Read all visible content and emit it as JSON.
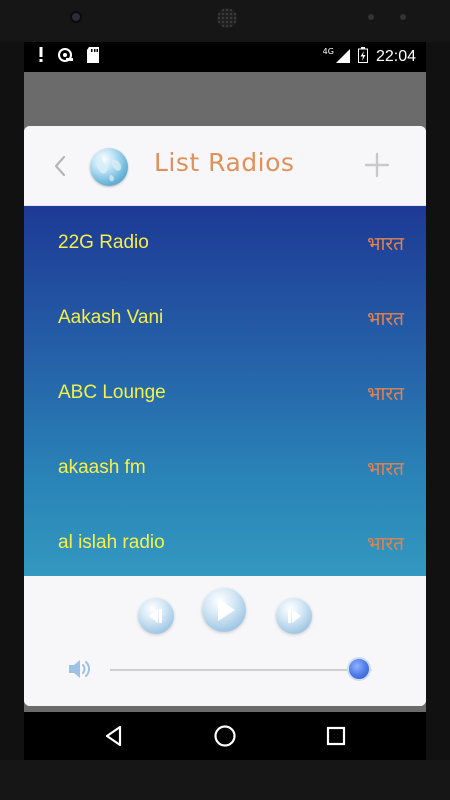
{
  "status_bar": {
    "time": "22:04",
    "network": "4G",
    "icons": [
      "alert-icon",
      "headset-icon",
      "sd-card-icon",
      "signal-icon",
      "battery-icon"
    ]
  },
  "dialog": {
    "title": "List Radios",
    "back_icon": "chevron-left-icon",
    "logo_icon": "globe-icon",
    "add_icon": "plus-icon"
  },
  "radios": [
    {
      "name": "22G Radio",
      "country": "भारत"
    },
    {
      "name": "Aakash Vani",
      "country": "भारत"
    },
    {
      "name": "ABC Lounge",
      "country": "भारत"
    },
    {
      "name": "akaash fm",
      "country": "भारत"
    },
    {
      "name": "al islah radio",
      "country": "भारत"
    }
  ],
  "player": {
    "prev_icon": "previous-icon",
    "play_icon": "play-icon",
    "next_icon": "next-icon",
    "volume_icon": "speaker-icon",
    "volume_level": 0.95
  },
  "nav": {
    "back_icon": "nav-back-icon",
    "home_icon": "nav-home-icon",
    "recents_icon": "nav-recents-icon"
  },
  "colors": {
    "title": "#e0905a",
    "radio_name": "#f6f04a",
    "radio_country": "#e2834f",
    "list_gradient_top": "#1d3a95",
    "list_gradient_bottom": "#3398bf",
    "slider_thumb": "#4c78e6"
  }
}
